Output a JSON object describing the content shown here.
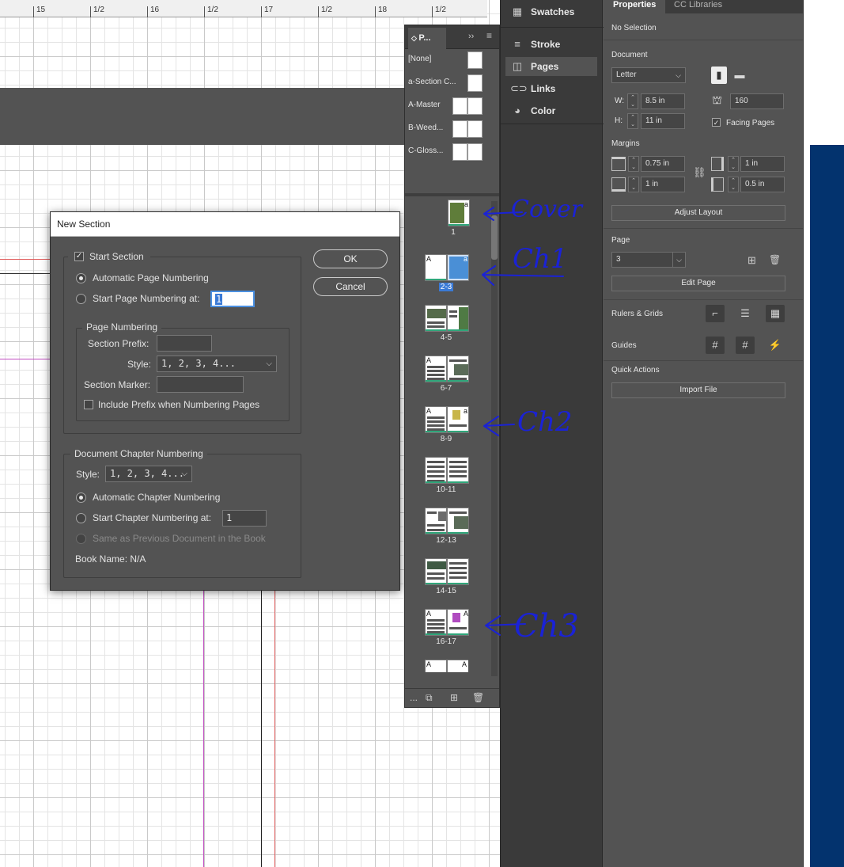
{
  "ruler": {
    "marks": [
      "15",
      "1/2",
      "16",
      "1/2",
      "17",
      "1/2",
      "18",
      "1/2"
    ]
  },
  "dialog": {
    "title": "New Section",
    "start_section": "Start Section",
    "auto_page_numbering": "Automatic Page Numbering",
    "start_page_numbering_at": "Start Page Numbering at:",
    "start_page_value": "1",
    "page_numbering_group": "Page Numbering",
    "section_prefix_label": "Section Prefix:",
    "section_prefix_value": "",
    "style_label": "Style:",
    "style_value": "1, 2, 3, 4...",
    "section_marker_label": "Section Marker:",
    "section_marker_value": "",
    "include_prefix": "Include Prefix when Numbering Pages",
    "chapter_group": "Document Chapter Numbering",
    "chapter_style_label": "Style:",
    "chapter_style_value": "1, 2, 3, 4...",
    "auto_chapter": "Automatic Chapter Numbering",
    "start_chapter_at": "Start Chapter Numbering at:",
    "start_chapter_value": "1",
    "same_as_previous": "Same as Previous Document in the Book",
    "book_name": "Book Name: N/A",
    "ok": "OK",
    "cancel": "Cancel"
  },
  "pages_panel": {
    "tab": "P...",
    "masters": [
      "[None]",
      "a-Section C...",
      "A-Master",
      "B-Weed...",
      "C-Gloss..."
    ],
    "spreads": [
      "1",
      "2-3",
      "4-5",
      "6-7",
      "8-9",
      "10-11",
      "12-13",
      "14-15",
      "16-17"
    ],
    "selected_spread": "2-3",
    "footer_more": "..."
  },
  "strip": {
    "items": [
      "Swatches",
      "Stroke",
      "Pages",
      "Links",
      "Color"
    ],
    "active": "Pages"
  },
  "properties": {
    "tabs": [
      "Properties",
      "CC Libraries"
    ],
    "no_selection": "No Selection",
    "document_label": "Document",
    "page_size": "Letter",
    "width_label": "W:",
    "width": "8.5 in",
    "height_label": "H:",
    "height": "11 in",
    "pages_count": "160",
    "facing_pages": "Facing Pages",
    "margins_label": "Margins",
    "margin_top": "0.75 in",
    "margin_bottom": "1 in",
    "margin_outside": "1 in",
    "margin_inside": "0.5 in",
    "adjust_layout": "Adjust Layout",
    "page_label": "Page",
    "page_value": "3",
    "edit_page": "Edit Page",
    "rulers_grids": "Rulers & Grids",
    "guides": "Guides",
    "quick_actions": "Quick Actions",
    "import_file": "Import File"
  },
  "annotations": {
    "texts": [
      "Cover",
      "Ch1",
      "Ch2",
      "Ch3"
    ],
    "color": "#1a22d6"
  }
}
